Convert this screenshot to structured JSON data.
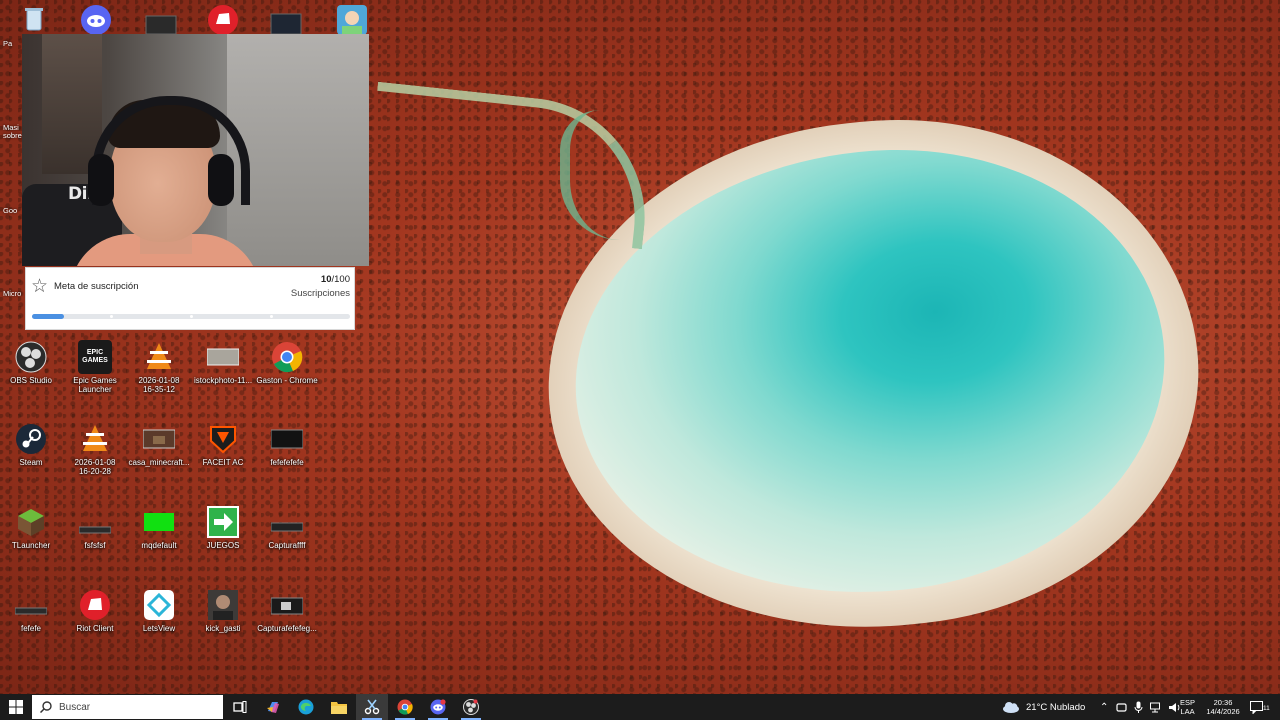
{
  "desktop": {
    "side_labels": [
      "Pa",
      "Masi\nsobre",
      "Goo",
      "Micro"
    ],
    "icons": [
      {
        "label": "OBS Studio",
        "icon": "obs-icon"
      },
      {
        "label": "Epic Games\nLauncher",
        "icon": "epic-games-icon",
        "glyph": "EPIC\nGAMES"
      },
      {
        "label": "2026-01-08\n16-35-12",
        "icon": "vlc-icon"
      },
      {
        "label": "istockphoto-11...",
        "icon": "image-thumbnail-icon"
      },
      {
        "label": "Gaston - Chrome",
        "icon": "chrome-icon"
      },
      {
        "label": "Steam",
        "icon": "steam-icon"
      },
      {
        "label": "2026-01-08\n16-20-28",
        "icon": "vlc-icon"
      },
      {
        "label": "casa_minecraft...",
        "icon": "image-thumbnail-icon"
      },
      {
        "label": "FACEIT AC",
        "icon": "faceit-icon"
      },
      {
        "label": "fefefefefe",
        "icon": "image-thumbnail-icon"
      },
      {
        "label": "TLauncher",
        "icon": "minecraft-block-icon"
      },
      {
        "label": "fsfsfsf",
        "icon": "image-thumbnail-icon"
      },
      {
        "label": "mqdefault",
        "icon": "green-image-icon"
      },
      {
        "label": "JUEGOS",
        "icon": "shortcut-arrow-icon"
      },
      {
        "label": "Capturaffff",
        "icon": "image-thumbnail-icon"
      },
      {
        "label": "fefefe",
        "icon": "image-thumbnail-icon"
      },
      {
        "label": "Riot Client",
        "icon": "riot-client-icon"
      },
      {
        "label": "LetsView",
        "icon": "letsview-icon"
      },
      {
        "label": "kick_gasti",
        "icon": "photo-icon"
      },
      {
        "label": "Capturafefefeg...",
        "icon": "image-thumbnail-icon"
      }
    ]
  },
  "subscription_goal": {
    "title": "Meta de suscripción",
    "current": "10",
    "total": "/100",
    "unit": "Suscripciones",
    "progress": 0.1
  },
  "taskbar": {
    "search_placeholder": "Buscar",
    "weather": "21°C  Nublado",
    "language": "ESP",
    "layout": "LAA",
    "time": "20:36",
    "date": "14/4/2026",
    "notification_count": "11",
    "apps": [
      "task-view-icon",
      "copilot-icon",
      "edge-icon",
      "file-explorer-icon",
      "snipping-tool-icon",
      "chrome-icon",
      "discord-icon",
      "obs-icon"
    ]
  }
}
